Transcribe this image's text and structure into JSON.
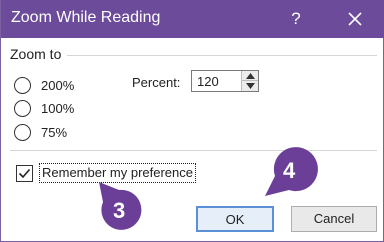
{
  "window": {
    "title": "Zoom While Reading",
    "help_label": "?",
    "close_icon": "close-icon"
  },
  "zoom_to": {
    "label": "Zoom to",
    "options": [
      {
        "label": "200%",
        "selected": false
      },
      {
        "label": "100%",
        "selected": false
      },
      {
        "label": "75%",
        "selected": false
      }
    ]
  },
  "percent": {
    "label": "Percent:",
    "value": "120"
  },
  "remember": {
    "label": "Remember my preference",
    "checked": true
  },
  "buttons": {
    "ok": "OK",
    "cancel": "Cancel"
  },
  "callouts": {
    "step3": "3",
    "step4": "4",
    "color": "#6b3f98"
  },
  "colors": {
    "titlebar": "#6b4b9a",
    "default_button_border": "#5b8fd6"
  }
}
